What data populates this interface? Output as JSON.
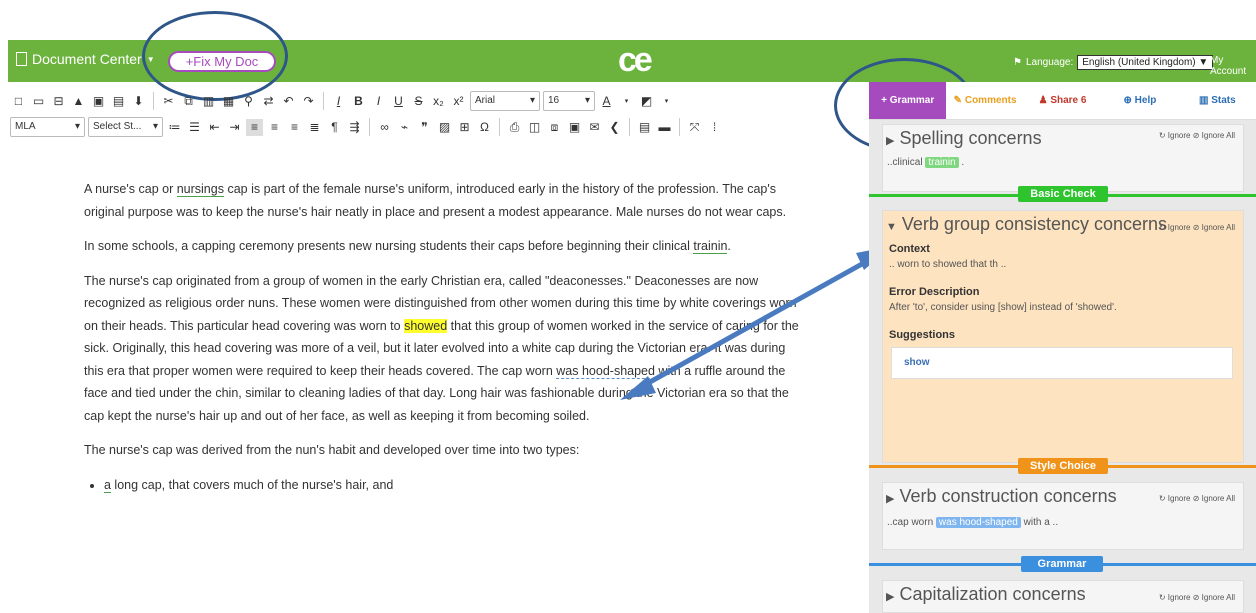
{
  "topbar": {
    "doc_center_label": "Document Center",
    "fix_button_label": "+Fix My Doc",
    "logo_text": "ce",
    "language_label": "Language:",
    "language_value": "English (United Kingdom)",
    "my_account_label": "My Account"
  },
  "toolbar": {
    "font_name": "Arial",
    "font_size": "16",
    "style_select": "MLA",
    "format_select": "Select St..."
  },
  "document": {
    "paragraphs": {
      "p1_a": "A nurse's cap or ",
      "p1_word": "nursings",
      "p1_b": " cap is part of the female nurse's uniform, introduced early in the history of the profession. The cap's original purpose was to keep the nurse's hair neatly in place and present a modest appearance. Male nurses do not wear caps.",
      "p2_a": "In some schools, a capping ceremony presents new nursing students their caps before beginning their clinical ",
      "p2_word": "trainin",
      "p2_b": ".",
      "p3_a": "The nurse's cap originated from a group of women in the early Christian era, called \"deaconesses.\" Deaconesses are now recognized as religious order nuns. These women were distinguished from other women during this time by white coverings worn on their heads. This particular head covering was worn to ",
      "p3_word": "showed",
      "p3_b": " that this group of women worked in the service of caring for the sick. Originally, this head covering was more of a veil, but it later evolved into a white cap during the Victorian era. It was during this era that proper women were required to keep their heads covered. The cap worn ",
      "p3_word2": "was hood-shaped",
      "p3_c": " with a ruffle around the face and tied under the chin, similar to cleaning ladies of that day. Long hair was fashionable during the Victorian era so that the cap kept the nurse's hair up and out of her face, as well as keeping it from becoming soiled.",
      "p4": "The nurse's cap was derived from the nun's habit and developed over time into two types:",
      "li1_word": "a",
      "li1": " long cap, that covers much of the nurse's hair, and"
    }
  },
  "sidebar": {
    "tabs": [
      "+ Grammar",
      "Comments",
      "Share 6",
      "Help",
      "Stats"
    ],
    "ignore": "Ignore",
    "ignore_all": "Ignore All",
    "cards": {
      "spelling": {
        "title": "Spelling concerns",
        "snip_pre": "..clinical ",
        "snip_tag": "trainin",
        "snip_post": " ."
      },
      "verb_group": {
        "title": "Verb group consistency concerns",
        "context_head": "Context",
        "context_text": ".. worn to showed that th ..",
        "error_head": "Error Description",
        "error_text": "After 'to', consider using [show] instead of 'showed'.",
        "sugg_head": "Suggestions",
        "sugg_value": "show"
      },
      "verb_construction": {
        "title": "Verb construction concerns",
        "snip_pre": "..cap worn ",
        "snip_tag": "was hood-shaped",
        "snip_post": " with a .."
      },
      "capitalization": {
        "title": "Capitalization concerns"
      }
    },
    "categories": {
      "basic": "Basic Check",
      "style": "Style Choice",
      "grammar": "Grammar"
    }
  },
  "colors": {
    "brand_green": "#6cb33e",
    "accent_purple": "#a64bbd",
    "annotation_blue": "#2f5689",
    "basic_check": "#2ec42e",
    "style_choice": "#f0931b",
    "grammar": "#3b8fdf"
  }
}
